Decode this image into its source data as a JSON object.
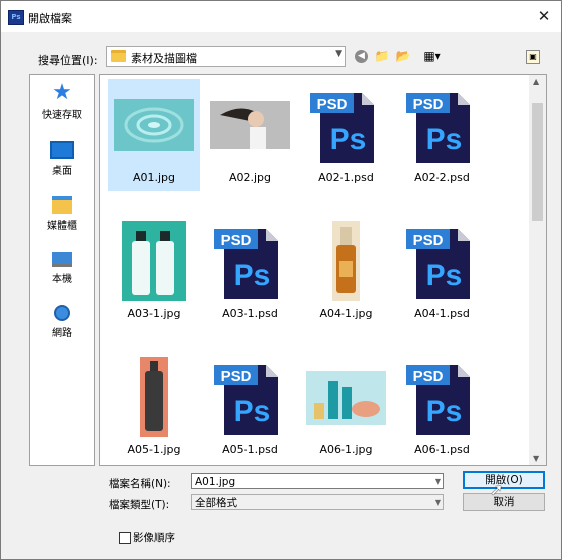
{
  "window": {
    "title": "開啟檔案",
    "app_badge": "Ps"
  },
  "lookin": {
    "label": "搜尋位置(I):",
    "value": "素材及描圖檔"
  },
  "places": [
    {
      "label": "快速存取",
      "icon": "star-icon"
    },
    {
      "label": "桌面",
      "icon": "desktop-icon"
    },
    {
      "label": "媒體櫃",
      "icon": "library-icon"
    },
    {
      "label": "本機",
      "icon": "computer-icon"
    },
    {
      "label": "網路",
      "icon": "network-icon"
    }
  ],
  "files": [
    {
      "name": "A01.jpg",
      "kind": "photo-water",
      "selected": true
    },
    {
      "name": "A02.jpg",
      "kind": "photo-woman"
    },
    {
      "name": "A02-1.psd",
      "kind": "psd"
    },
    {
      "name": "A02-2.psd",
      "kind": "psd"
    },
    {
      "name": "A03-1.jpg",
      "kind": "photo-bottles"
    },
    {
      "name": "A03-1.psd",
      "kind": "psd"
    },
    {
      "name": "A04-1.jpg",
      "kind": "photo-serum"
    },
    {
      "name": "A04-1.psd",
      "kind": "psd"
    },
    {
      "name": "A05-1.jpg",
      "kind": "photo-darkbottle"
    },
    {
      "name": "A05-1.psd",
      "kind": "psd"
    },
    {
      "name": "A06-1.jpg",
      "kind": "photo-cosmetics"
    },
    {
      "name": "A06-1.psd",
      "kind": "psd"
    }
  ],
  "psd_badge": "PSD",
  "ps_letters": "Ps",
  "filename": {
    "label": "檔案名稱(N):",
    "value": "A01.jpg"
  },
  "filetype": {
    "label": "檔案類型(T):",
    "value": "全部格式"
  },
  "buttons": {
    "open": "開啟(O)",
    "cancel": "取消"
  },
  "sequence": {
    "label": "影像順序",
    "checked": false
  },
  "colors": {
    "psd_dark": "#1b1a4e",
    "psd_accent": "#2d7fd6",
    "selection": "#cce8ff"
  }
}
